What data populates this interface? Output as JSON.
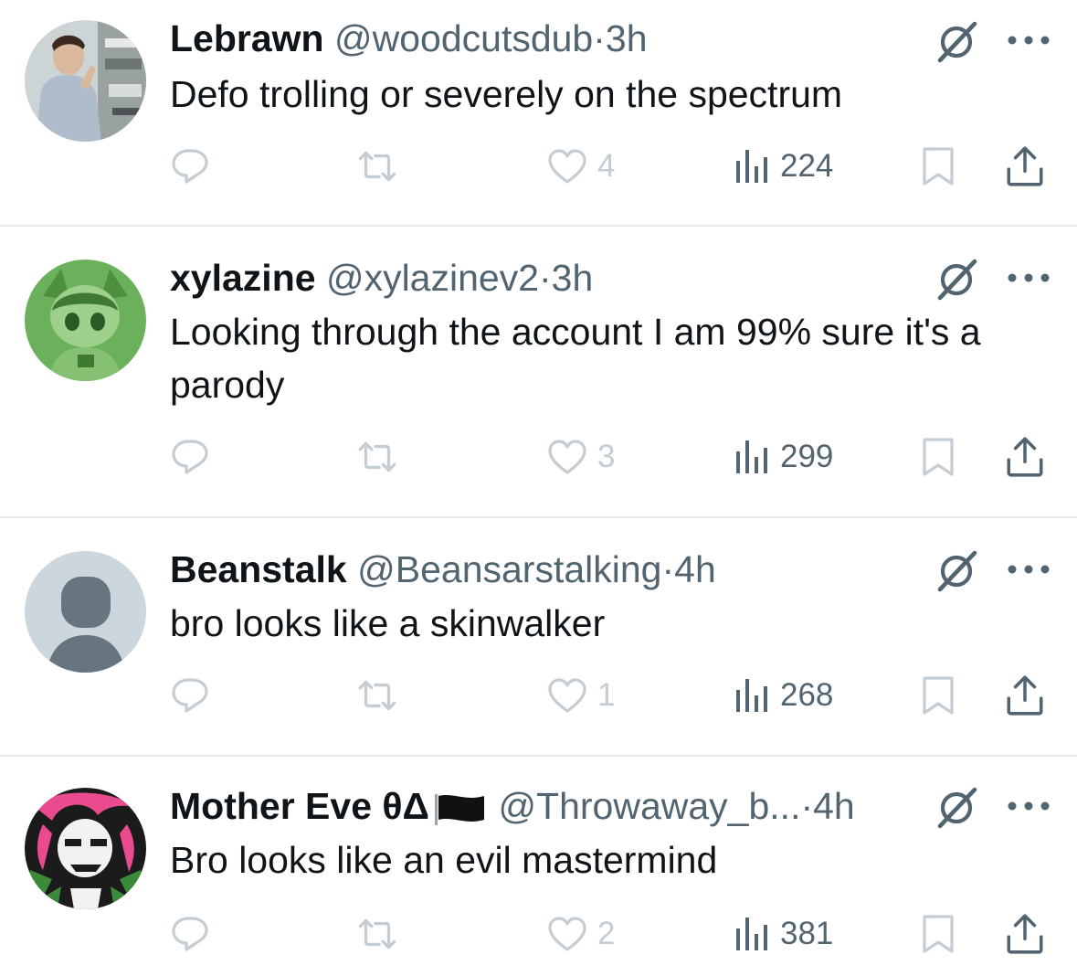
{
  "tweets": [
    {
      "name": "Lebrawn",
      "handle": "@woodcutsdub",
      "separator": "·",
      "time": "3h",
      "text": "Defo trolling or severely on the spectrum",
      "likes": "4",
      "views": "224",
      "avatar": "photo-man-pointing"
    },
    {
      "name": "xylazine",
      "handle": "@xylazinev2",
      "separator": "·",
      "time": "3h",
      "text": "Looking through the account I am 99% sure it's a parody",
      "likes": "3",
      "views": "299",
      "avatar": "green-anime-character"
    },
    {
      "name": "Beanstalk",
      "handle": "@Beansarstalking",
      "separator": "·",
      "time": "4h",
      "text": "bro looks like a skinwalker",
      "likes": "1",
      "views": "268",
      "avatar": "default-profile"
    },
    {
      "name": "Mother Eve θΔ",
      "handle": "@Throwaway_b...",
      "separator": "·",
      "time": "4h",
      "text": "Bro looks like an evil mastermind",
      "likes": "2",
      "views": "381",
      "avatar": "pink-black-anime-character"
    }
  ],
  "icons": {
    "reply": "reply-icon",
    "retweet": "retweet-icon",
    "like": "heart-icon",
    "views": "views-chart-icon",
    "bookmark": "bookmark-icon",
    "share": "share-icon",
    "grok": "grok-icon",
    "more": "more-icon"
  },
  "colors": {
    "text": "#0f1419",
    "secondary": "#536471",
    "faint_icon": "#c4cdd3",
    "divider": "#e7e9ec"
  }
}
